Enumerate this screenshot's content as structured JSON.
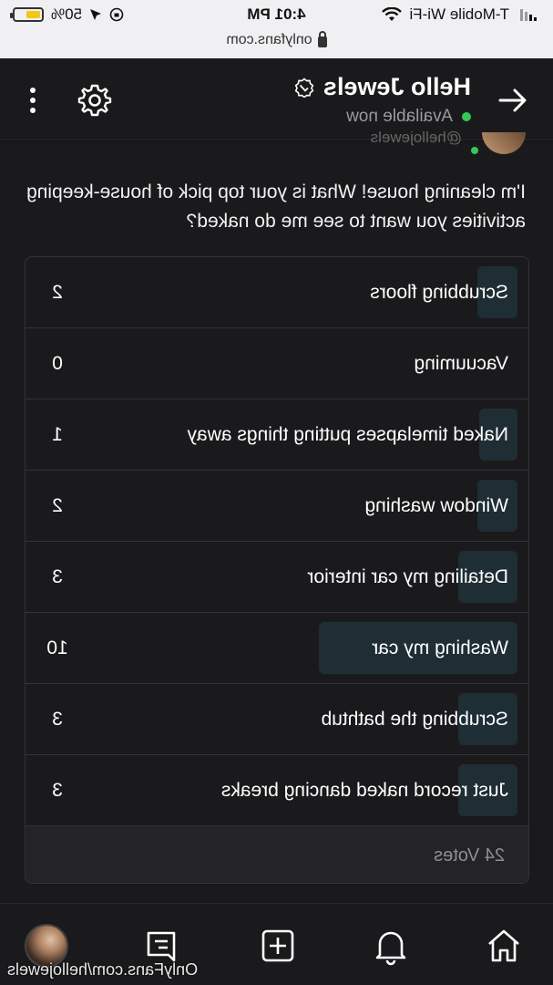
{
  "status_bar": {
    "carrier": "T-Mobile Wi-Fi",
    "time": "4:01 PM",
    "battery": "50%",
    "url": "onlyfans.com"
  },
  "header": {
    "title": "Hello Jewels",
    "status": "Available now"
  },
  "post": {
    "cutoff_handle": "@hellojewels",
    "text": "I'm cleaning house! What is your top pick of house-keeping activities you want to see me do naked?"
  },
  "poll": {
    "options": [
      {
        "label": "Scrubbing floors",
        "count": "2",
        "fraction": 0.2
      },
      {
        "label": "Vacuuming",
        "count": "0",
        "fraction": 0.0
      },
      {
        "label": "Naked timelapses putting things away",
        "count": "1",
        "fraction": 0.1
      },
      {
        "label": "Window washing",
        "count": "2",
        "fraction": 0.2
      },
      {
        "label": "Detailing my car interior",
        "count": "3",
        "fraction": 0.3
      },
      {
        "label": "Washing my car",
        "count": "10",
        "fraction": 1.0
      },
      {
        "label": "Scrubbing the bathtub",
        "count": "3",
        "fraction": 0.3
      },
      {
        "label": "Just record naked dancing breaks",
        "count": "3",
        "fraction": 0.3
      }
    ],
    "votes": "24 Votes"
  },
  "watermark": "OnlyFans.com/hellojewels",
  "colors": {
    "background": "#1a1a1c",
    "poll_bar": "#1f2d35",
    "online": "#35c759",
    "battery": "#f5c518"
  },
  "icons": [
    "back-arrow-icon",
    "verified-icon",
    "gear-icon",
    "more-vertical-icon",
    "home-icon",
    "bell-icon",
    "add-icon",
    "chat-icon",
    "lock-icon",
    "wifi-icon"
  ]
}
